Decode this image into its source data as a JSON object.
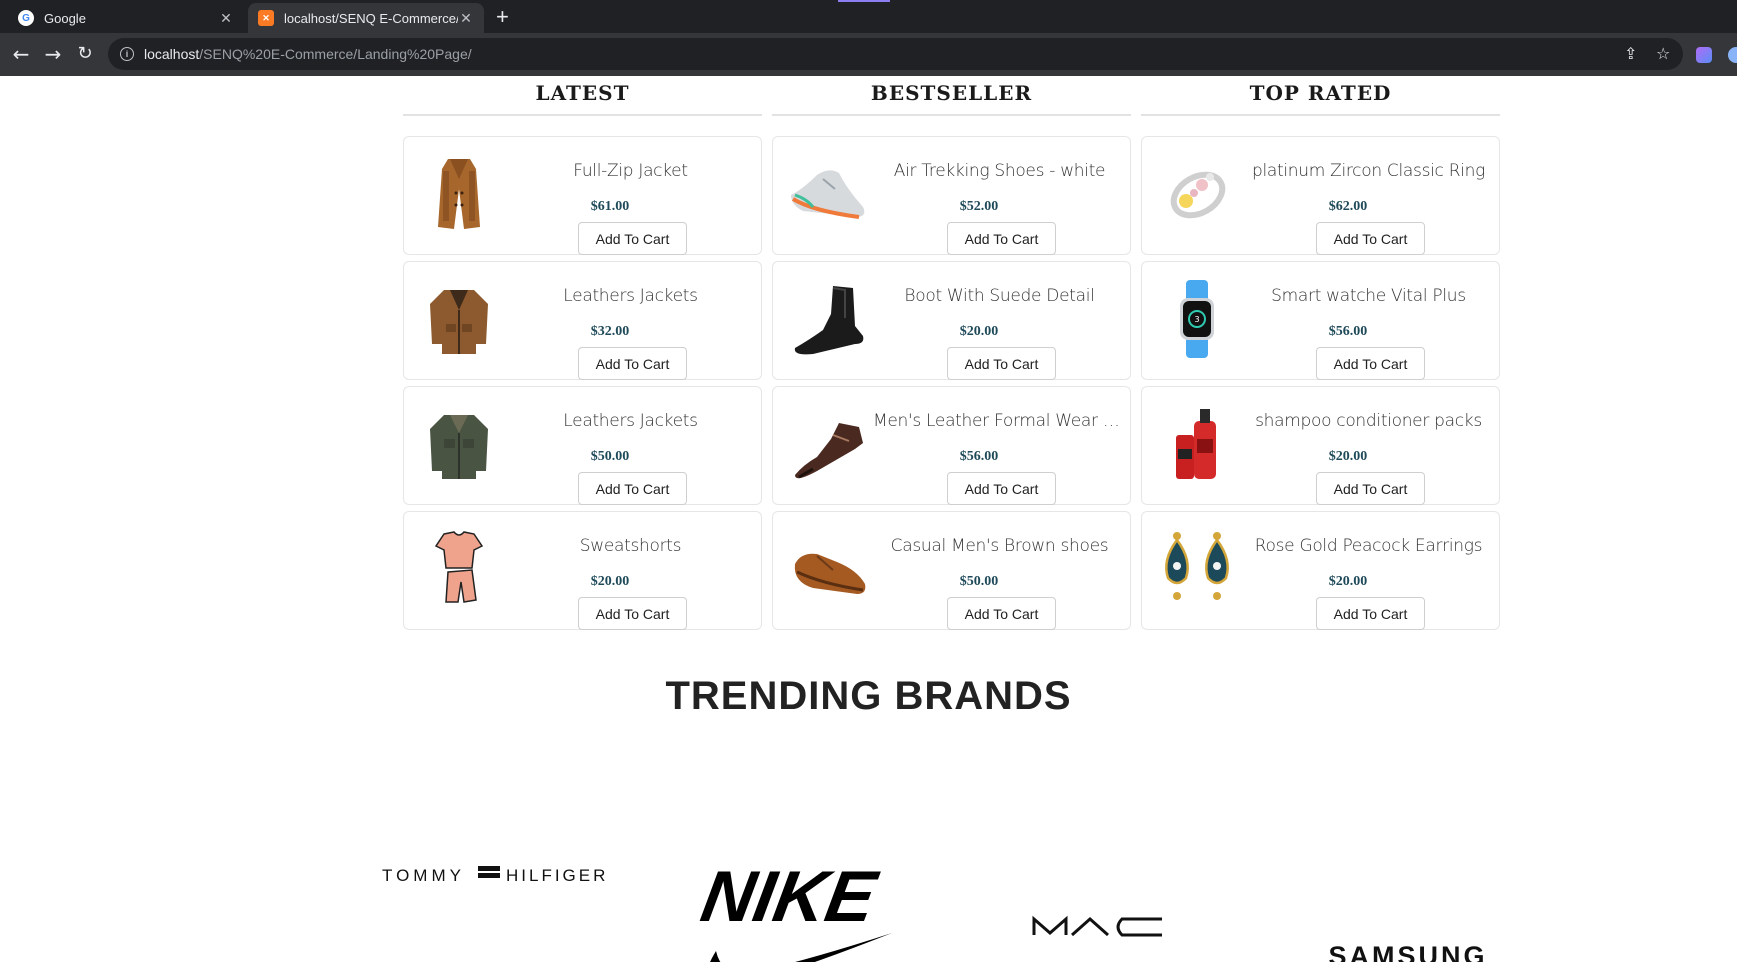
{
  "browser": {
    "tabs": [
      {
        "title": "Google",
        "favicon": "google-icon",
        "active": false
      },
      {
        "title": "localhost/SENQ E-Commerce/La",
        "favicon": "xampp-icon",
        "active": true
      }
    ],
    "url_host": "localhost",
    "url_path": "/SENQ%20E-Commerce/Landing%20Page/"
  },
  "columns": [
    {
      "heading": "LATEST",
      "products": [
        {
          "name": "Full-Zip Jacket",
          "price": "$61.00",
          "button": "Add To Cart",
          "image": "coat-image"
        },
        {
          "name": "Leathers Jackets",
          "price": "$32.00",
          "button": "Add To Cart",
          "image": "jacket-brown-image"
        },
        {
          "name": "Leathers Jackets",
          "price": "$50.00",
          "button": "Add To Cart",
          "image": "jacket-green-image"
        },
        {
          "name": "Sweatshorts",
          "price": "$20.00",
          "button": "Add To Cart",
          "image": "sweatshorts-image"
        }
      ]
    },
    {
      "heading": "BESTSELLER",
      "products": [
        {
          "name": "Air Trekking Shoes - white",
          "price": "$52.00",
          "button": "Add To Cart",
          "image": "sneaker-image"
        },
        {
          "name": "Boot With Suede Detail",
          "price": "$20.00",
          "button": "Add To Cart",
          "image": "boot-image"
        },
        {
          "name": "Men's Leather Formal Wear s...",
          "price": "$56.00",
          "button": "Add To Cart",
          "image": "formal-shoe-image"
        },
        {
          "name": "Casual Men's Brown shoes",
          "price": "$50.00",
          "button": "Add To Cart",
          "image": "brown-shoe-image"
        }
      ]
    },
    {
      "heading": "TOP RATED",
      "products": [
        {
          "name": "platinum Zircon Classic Ring",
          "price": "$62.00",
          "button": "Add To Cart",
          "image": "ring-image"
        },
        {
          "name": "Smart watche Vital Plus",
          "price": "$56.00",
          "button": "Add To Cart",
          "image": "smartwatch-image"
        },
        {
          "name": "shampoo conditioner packs",
          "price": "$20.00",
          "button": "Add To Cart",
          "image": "shampoo-image"
        },
        {
          "name": "Rose Gold Peacock Earrings",
          "price": "$20.00",
          "button": "Add To Cart",
          "image": "earrings-image"
        }
      ]
    }
  ],
  "trending_title": "TRENDING BRANDS",
  "brands": [
    "TOMMY HILFIGER",
    "NIKE",
    "MAC",
    "SAMSUNG"
  ]
}
